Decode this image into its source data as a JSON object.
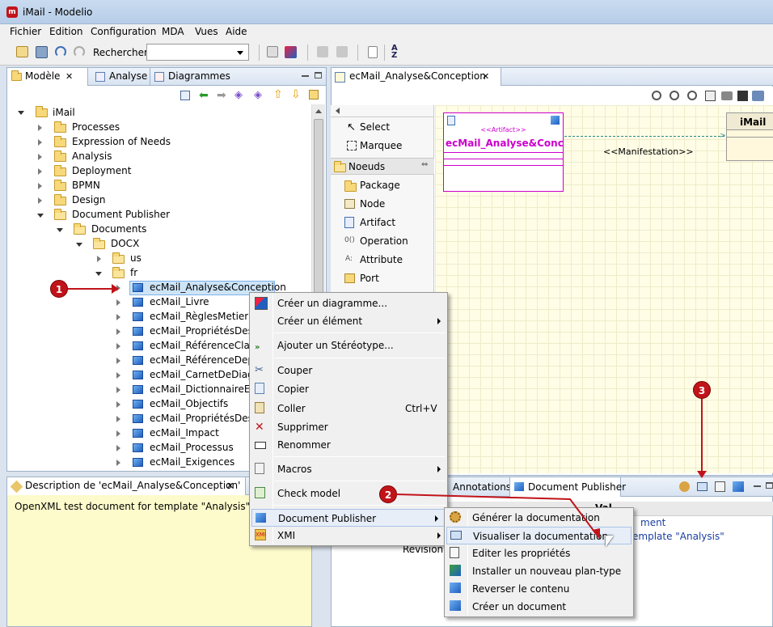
{
  "window": {
    "title": "iMail - Modelio"
  },
  "menubar": [
    "Fichier",
    "Edition",
    "Configuration",
    "MDA",
    "Vues",
    "Aide"
  ],
  "toolbar": {
    "search_label": "Rechercher :",
    "search_value": ""
  },
  "left_tabs": [
    {
      "label": "Modèle",
      "active": true
    },
    {
      "label": "Analyse"
    },
    {
      "label": "Diagrammes"
    }
  ],
  "tree": {
    "root": "iMail",
    "children": [
      "Processes",
      "Expression of Needs",
      "Analysis",
      "Deployment",
      "BPMN",
      "Design",
      "Document Publisher"
    ],
    "documents": "Documents",
    "docx": "DOCX",
    "us": "us",
    "fr": "fr",
    "items": [
      "ecMail_Analyse&Conception",
      "ecMail_Livre",
      "ecMail_RèglesMetier",
      "ecMail_PropriétésDesRè",
      "ecMail_RéférenceClasse",
      "ecMail_RéférenceDeplo",
      "ecMail_CarnetDeDiagra",
      "ecMail_DictionnaireEte",
      "ecMail_Objectifs",
      "ecMail_PropriétésDesO",
      "ecMail_Impact",
      "ecMail_Processus",
      "ecMail_Exigences"
    ]
  },
  "editor_tab": {
    "label": "ecMail_Analyse&Conception"
  },
  "palette": {
    "tools": [
      "Select",
      "Marquee"
    ],
    "group": "Noeuds",
    "items": [
      "Package",
      "Node",
      "Artifact",
      "Operation",
      "Attribute",
      "Port"
    ]
  },
  "diagram": {
    "artifact_stereotype": "<<Artifact>>",
    "artifact_name": "ecMail_Analyse&Conce...",
    "manifestation": "<<Manifestation>>",
    "target_name": "iMail"
  },
  "description": {
    "title": "Description de 'ecMail_Analyse&Conception'",
    "text": "OpenXML test document for template \"Analysis\""
  },
  "bottom_tabs": [
    "Annotations",
    "Document Publisher"
  ],
  "properties": {
    "header": "Val",
    "cells": [
      "ment",
      "emplate \"Analysis\""
    ],
    "revision_label": "Révision"
  },
  "context_menu": [
    {
      "label": "Créer un diagramme..."
    },
    {
      "label": "Créer un élément"
    },
    {
      "label": "Ajouter un Stéréotype..."
    },
    {
      "label": "Couper"
    },
    {
      "label": "Copier"
    },
    {
      "label": "Coller",
      "shortcut": "Ctrl+V"
    },
    {
      "label": "Supprimer"
    },
    {
      "label": "Renommer"
    },
    {
      "label": "Macros"
    },
    {
      "label": "Check model"
    },
    {
      "label": "Document Publisher"
    },
    {
      "label": "XMI"
    }
  ],
  "submenu": [
    {
      "label": "Générer la documentation"
    },
    {
      "label": "Visualiser la documentation"
    },
    {
      "label": "Editer les propriétés"
    },
    {
      "label": "Installer un nouveau plan-type"
    },
    {
      "label": "Reverser le contenu"
    },
    {
      "label": "Créer un document"
    }
  ],
  "callouts": [
    "1",
    "2",
    "3"
  ],
  "colors": {
    "callout": "#c0141a",
    "selection": "#cde4f7",
    "artifact": "#cc00cc",
    "editor_bg": "#fffde6",
    "description_bg": "#fdfacb"
  }
}
